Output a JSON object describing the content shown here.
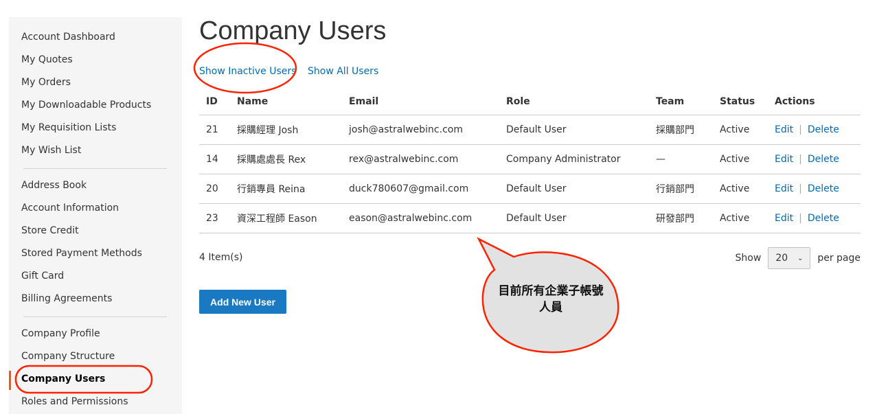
{
  "sidebar": {
    "items": [
      {
        "label": "Account Dashboard"
      },
      {
        "label": "My Quotes"
      },
      {
        "label": "My Orders"
      },
      {
        "label": "My Downloadable Products"
      },
      {
        "label": "My Requisition Lists"
      },
      {
        "label": "My Wish List"
      },
      {
        "label": "Address Book"
      },
      {
        "label": "Account Information"
      },
      {
        "label": "Store Credit"
      },
      {
        "label": "Stored Payment Methods"
      },
      {
        "label": "Gift Card"
      },
      {
        "label": "Billing Agreements"
      },
      {
        "label": "Company Profile"
      },
      {
        "label": "Company Structure"
      },
      {
        "label": "Company Users",
        "active": true
      },
      {
        "label": "Roles and Permissions"
      }
    ]
  },
  "page": {
    "title": "Company Users",
    "show_inactive": "Show Inactive Users",
    "show_all": "Show All Users"
  },
  "table": {
    "headers": [
      "ID",
      "Name",
      "Email",
      "Role",
      "Team",
      "Status",
      "Actions"
    ],
    "rows": [
      {
        "id": "21",
        "name": "採購經理 Josh",
        "email": "josh@astralwebinc.com",
        "role": "Default User",
        "team": "採購部門",
        "status": "Active",
        "edit": "Edit",
        "delete": "Delete"
      },
      {
        "id": "14",
        "name": "採購處處長 Rex",
        "email": "rex@astralwebinc.com",
        "role": "Company Administrator",
        "team": "—",
        "status": "Active",
        "edit": "Edit",
        "delete": "Delete"
      },
      {
        "id": "20",
        "name": "行銷專員 Reina",
        "email": "duck780607@gmail.com",
        "role": "Default User",
        "team": "行銷部門",
        "status": "Active",
        "edit": "Edit",
        "delete": "Delete"
      },
      {
        "id": "23",
        "name": "資深工程師 Eason",
        "email": "eason@astralwebinc.com",
        "role": "Default User",
        "team": "研發部門",
        "status": "Active",
        "edit": "Edit",
        "delete": "Delete"
      }
    ]
  },
  "toolbar": {
    "count": "4 Item(s)",
    "show": "Show",
    "limit": "20",
    "per_page": "per page",
    "add_user": "Add New User"
  },
  "annotation": {
    "callout_line1": "目前所有企業子帳號",
    "callout_line2": "人員",
    "color": "#ff2200"
  }
}
